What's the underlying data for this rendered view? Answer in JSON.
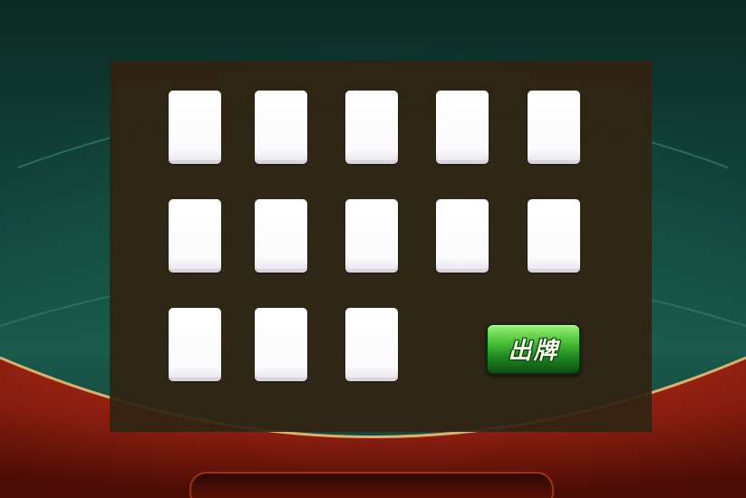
{
  "hand": {
    "cards": [
      {
        "face": ""
      },
      {
        "face": ""
      },
      {
        "face": ""
      },
      {
        "face": ""
      },
      {
        "face": ""
      },
      {
        "face": ""
      },
      {
        "face": ""
      },
      {
        "face": ""
      },
      {
        "face": ""
      },
      {
        "face": ""
      },
      {
        "face": ""
      },
      {
        "face": ""
      },
      {
        "face": ""
      }
    ]
  },
  "actions": {
    "play_label": "出牌"
  },
  "colors": {
    "felt": "#12473e",
    "table_rim": "#8a1e10",
    "panel": "#322412",
    "card": "#ffffff",
    "button": "#2a9a2a"
  }
}
